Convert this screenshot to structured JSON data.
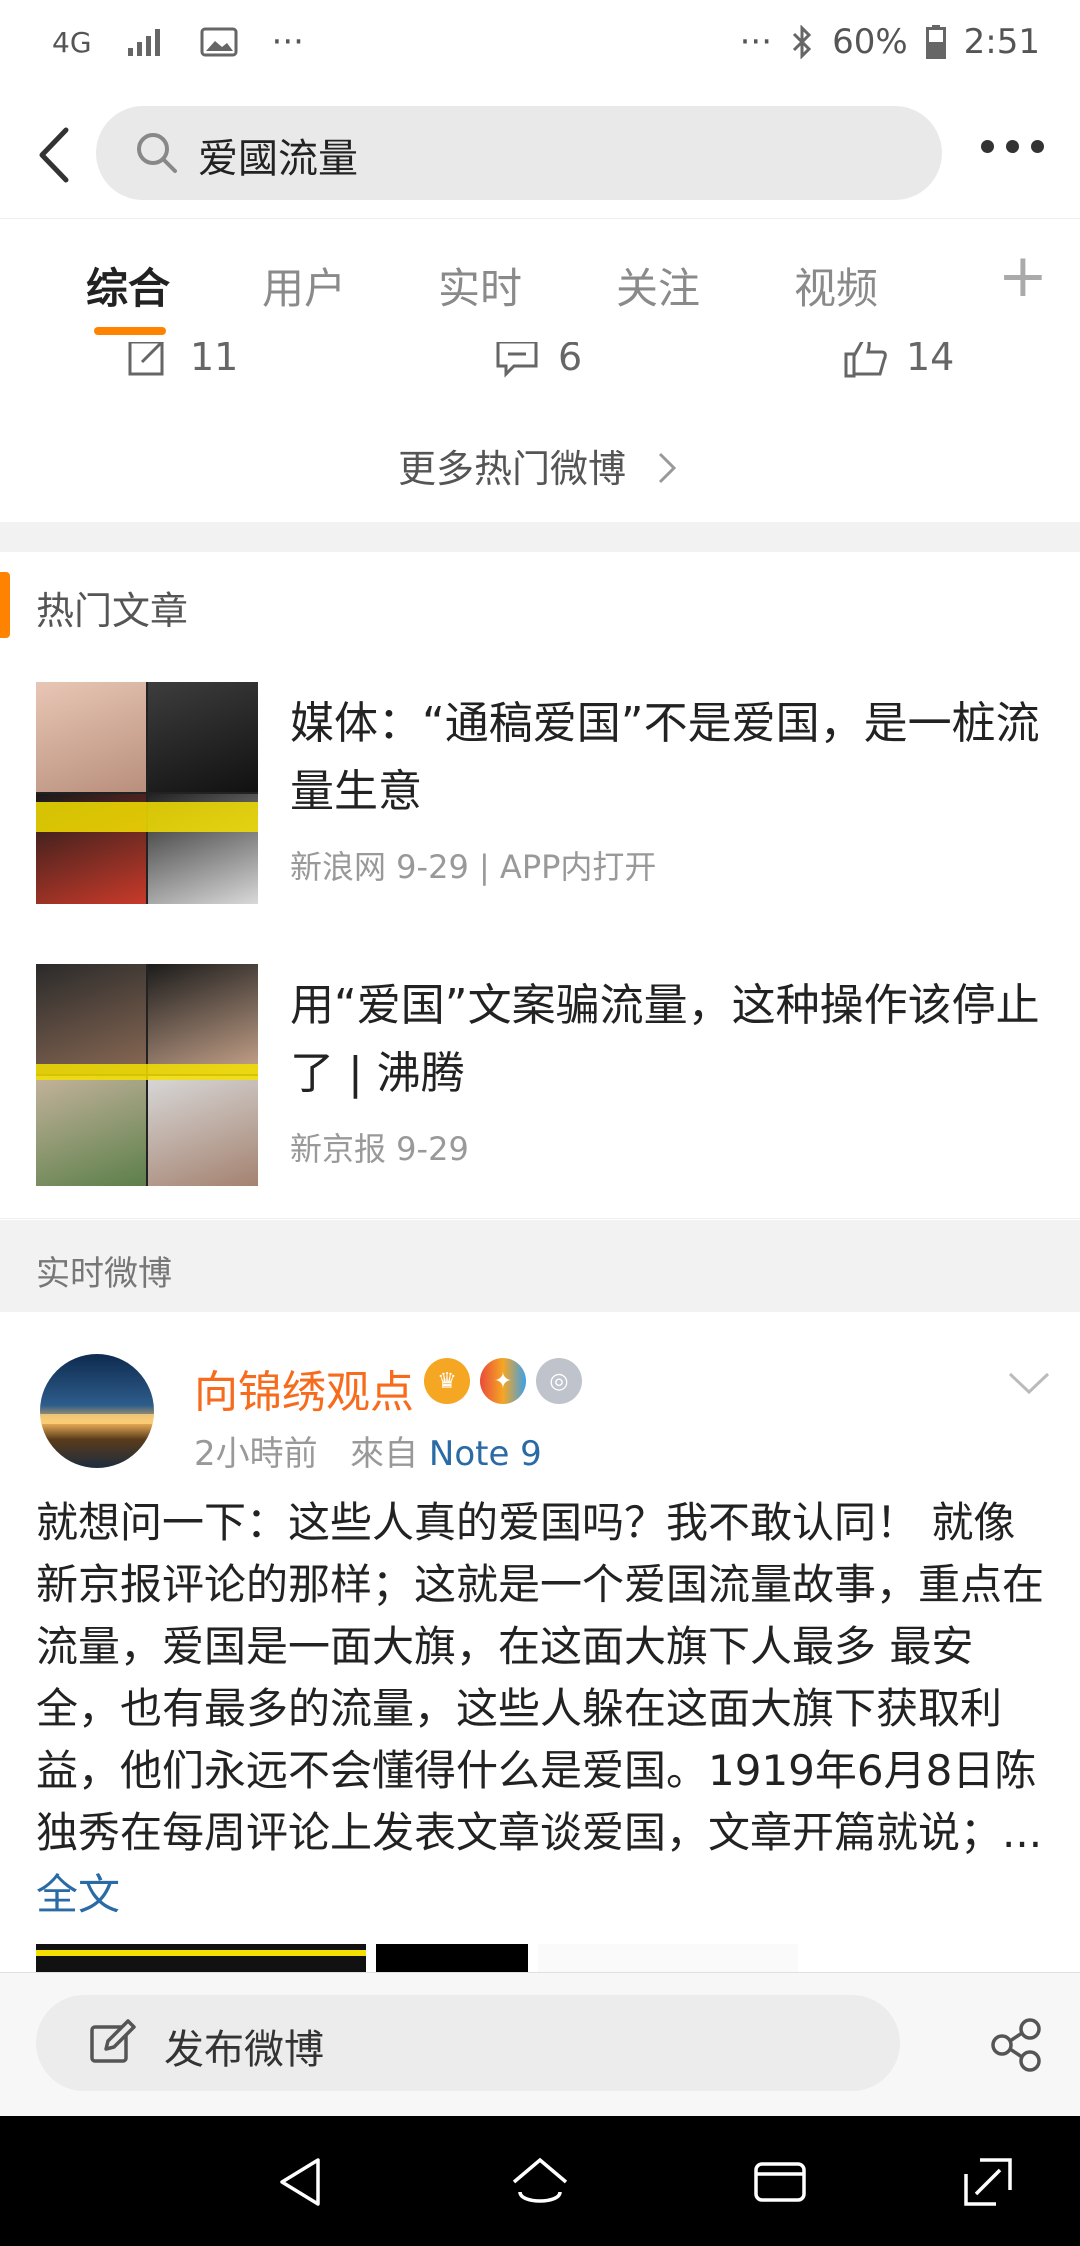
{
  "status_bar": {
    "network": "4G",
    "signal": "signal",
    "ellipsis_left": "···",
    "ellipsis_right": "···",
    "battery": "60%",
    "time": "2:51"
  },
  "search": {
    "query": "爱國流量"
  },
  "tabs": [
    {
      "label": "综合",
      "active": true
    },
    {
      "label": "用户"
    },
    {
      "label": "实时"
    },
    {
      "label": "关注"
    },
    {
      "label": "视频"
    }
  ],
  "tab_add": "+",
  "prev_post_actions": {
    "repost": "11",
    "comment": "6",
    "like": "14"
  },
  "more_hot": "更多热门微博",
  "hot_articles": {
    "title": "热门文章",
    "items": [
      {
        "title": "媒体：“通稿爱国”不是爱国，是一桩流量生意",
        "meta": "新浪网  9-29 | APP内打开"
      },
      {
        "title": "用“爱国”文案骗流量，这种操作该停止了 | 沸腾",
        "meta": "新京报  9-29"
      }
    ]
  },
  "realtime": {
    "title": "实时微博",
    "post": {
      "username": "向锦绣观点",
      "time": "2小時前",
      "from_label": "來自",
      "device": "Note 9",
      "text": "就想问一下：这些人真的爱国吗？我不敢认同！ 就像新京报评论的那样；这就是一个爱国流量故事，重点在流量，爱国是一面大旗，在这面大旗下人最多 最安全，也有最多的流量，这些人躲在这面大旗下获取利益，他们永远不会懂得什么是爱国。1919年6月8日陈独秀在每周评论上发表文章谈爱国，文章开篇就说；... ",
      "full_text_link": "全文"
    }
  },
  "compose": {
    "label": "发布微博"
  },
  "colors": {
    "accent": "#ff8200",
    "username": "#f76b1c",
    "link": "#2a6aa5"
  }
}
